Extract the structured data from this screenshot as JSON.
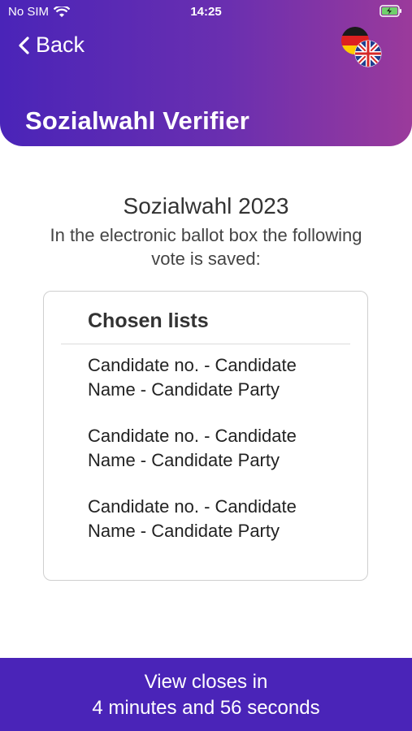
{
  "status_bar": {
    "carrier": "No SIM",
    "time": "14:25"
  },
  "nav": {
    "back_label": "Back",
    "language_icon": "language-flag-de-uk-icon"
  },
  "header": {
    "app_title": "Sozialwahl Verifier",
    "gradient_start": "#4a24b8",
    "gradient_end": "#9b3a9b"
  },
  "election": {
    "title": "Sozialwahl 2023",
    "description": "In the electronic ballot box the following vote is saved:"
  },
  "card": {
    "heading": "Chosen lists",
    "candidates": [
      "Candidate no. - Candidate Name - Candidate Party",
      "Candidate no. - Candidate Name - Candidate Party",
      "Candidate no. - Candidate Name - Candidate Party"
    ]
  },
  "footer": {
    "line1": "View closes in",
    "line2": "4 minutes and 56 seconds",
    "color": "#4a24b8"
  }
}
